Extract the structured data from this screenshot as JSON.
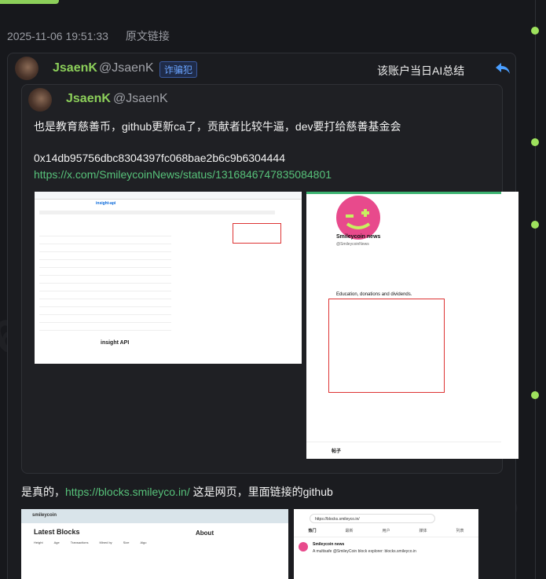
{
  "post": {
    "timestamp": "2025-11-06 19:51:33",
    "original_link": "原文链接"
  },
  "tweet": {
    "name": "JsaenK",
    "handle": "@JsaenK",
    "badge": "诈骗犯",
    "summary_label": "该账户当日AI总结",
    "reply_icon": "reply-arrow-icon"
  },
  "quoted": {
    "name": "JsaenK",
    "handle": "@JsaenK",
    "text": "也是教育慈善币，github更新ca了，贡献者比较牛逼，dev要打给慈善基金会",
    "address": "0x14db95756dbc8304397fc068bae2b6c9b6304444",
    "link": "https://x.com/SmileycoinNews/status/1316846747835084801",
    "image1": {
      "repo": "insight-api",
      "readme_title": "insight API"
    },
    "image2": {
      "profile_name": "Smileycoin news",
      "handle": "@SmileycoinNews",
      "description": "Education, donations and dividends.",
      "tab": "帖子"
    }
  },
  "reply_text": {
    "prefix": "是真的，",
    "link": "https://blocks.smileyco.in/",
    "suffix": " 这是网页，里面链接的github"
  },
  "image3": {
    "brand": "smileycoin",
    "heading": "Latest Blocks",
    "about": "About",
    "columns": [
      "Height",
      "Age",
      "Transactions",
      "Mined by",
      "Size",
      "Algo"
    ]
  },
  "image4": {
    "url": "https://blocks.smileyco.in/",
    "tabs": [
      "热门",
      "最新",
      "用户",
      "媒体",
      "列表"
    ],
    "tweet_name": "Smileycoin news",
    "tweet_text": "A multisafe @SmileyCoin block explorer: blocks.smileyco.in"
  },
  "watermark": "655"
}
